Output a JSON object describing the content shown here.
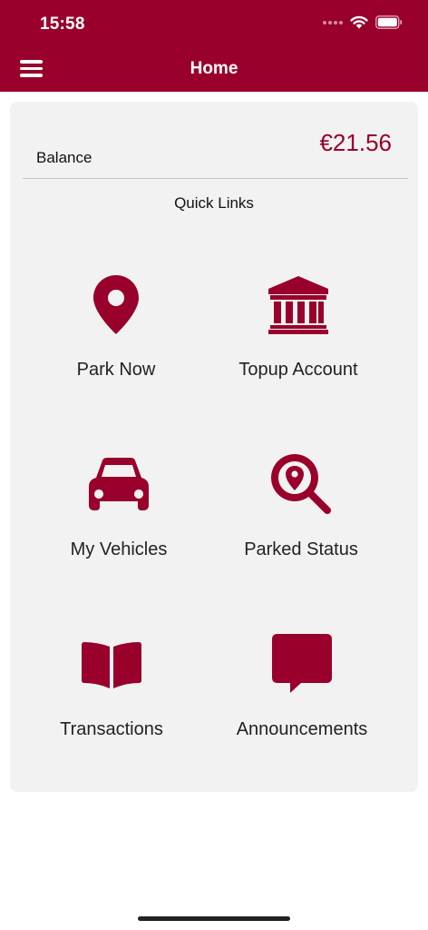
{
  "status_bar": {
    "time": "15:58"
  },
  "header": {
    "title": "Home",
    "background": "#99002b",
    "menu_icon": "hamburger-icon"
  },
  "balance": {
    "label": "Balance",
    "value": "€21.56",
    "value_color": "#99002b"
  },
  "quick_links": {
    "title": "Quick Links",
    "items": [
      {
        "label": "Park Now",
        "icon": "map-pin-icon"
      },
      {
        "label": "Topup Account",
        "icon": "bank-icon"
      },
      {
        "label": "My Vehicles",
        "icon": "car-icon"
      },
      {
        "label": "Parked Status",
        "icon": "search-location-icon"
      },
      {
        "label": "Transactions",
        "icon": "book-icon"
      },
      {
        "label": "Announcements",
        "icon": "speech-bubble-icon"
      }
    ]
  },
  "accent_color": "#99002b"
}
